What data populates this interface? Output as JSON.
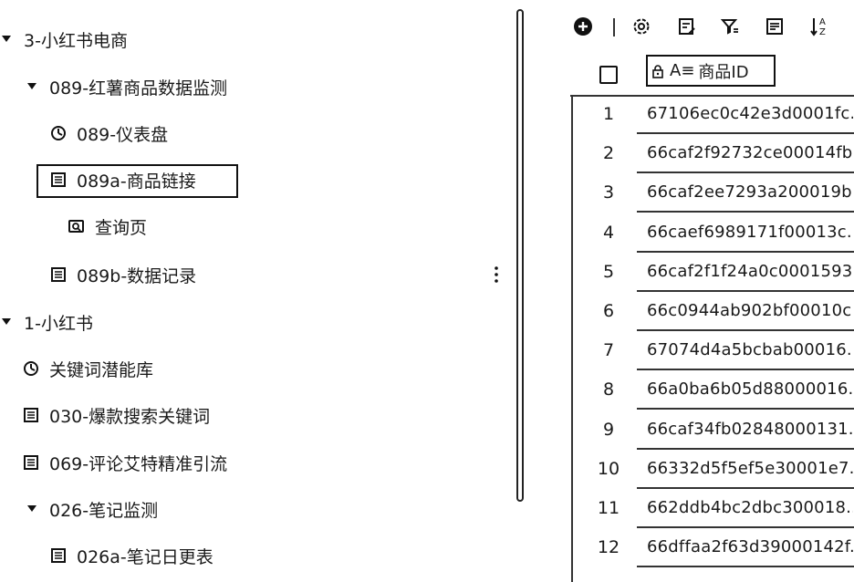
{
  "tree": {
    "items": [
      {
        "label": "3-小红书电商",
        "icon": "caret-down-icon"
      },
      {
        "label": "089-红薯商品数据监测",
        "icon": "caret-down-icon"
      },
      {
        "label": "089-仪表盘",
        "icon": "dashboard-icon"
      },
      {
        "label": "089a-商品链接",
        "icon": "table-icon"
      },
      {
        "label": "查询页",
        "icon": "query-page-icon"
      },
      {
        "label": "089b-数据记录",
        "icon": "table-icon"
      },
      {
        "label": "1-小红书",
        "icon": "caret-down-icon"
      },
      {
        "label": "关键词潜能库",
        "icon": "dashboard-icon"
      },
      {
        "label": "030-爆款搜索关键词",
        "icon": "table-icon"
      },
      {
        "label": "069-评论艾特精准引流",
        "icon": "table-icon"
      },
      {
        "label": "026-笔记监测",
        "icon": "caret-down-icon"
      },
      {
        "label": "026a-笔记日更表",
        "icon": "table-icon"
      }
    ]
  },
  "toolbar": {
    "icons": [
      "add-icon",
      "settings-icon",
      "edit-form-icon",
      "filter-icon",
      "form-icon",
      "sort-icon"
    ]
  },
  "table": {
    "column_header": "商品ID",
    "type_glyph": "A≡",
    "rows": [
      {
        "num": "1",
        "value": "67106ec0c42e3d0001fc..."
      },
      {
        "num": "2",
        "value": "66caf2f92732ce00014fb..."
      },
      {
        "num": "3",
        "value": "66caf2ee7293a200019b..."
      },
      {
        "num": "4",
        "value": "66caef6989171f00013c..."
      },
      {
        "num": "5",
        "value": "66caf2f1f24a0c0001593..."
      },
      {
        "num": "6",
        "value": "66c0944ab902bf00010c..."
      },
      {
        "num": "7",
        "value": "67074d4a5bcbab00016..."
      },
      {
        "num": "8",
        "value": "66a0ba6b05d88000016..."
      },
      {
        "num": "9",
        "value": "66caf34fb02848000131..."
      },
      {
        "num": "10",
        "value": "66332d5f5ef5e30001e7..."
      },
      {
        "num": "11",
        "value": "662ddb4bc2dbc300018..."
      },
      {
        "num": "12",
        "value": "66dffaa2f63d39000142f..."
      }
    ]
  }
}
